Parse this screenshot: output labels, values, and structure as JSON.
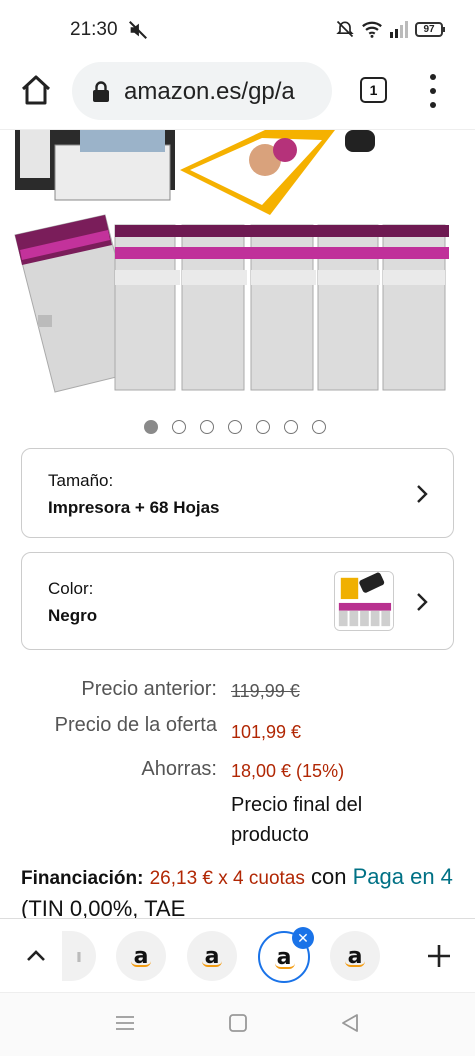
{
  "status_bar": {
    "time": "21:30",
    "battery": "97",
    "icons": [
      "mute-icon",
      "alarm-off-icon",
      "wifi-icon",
      "signal-icon",
      "battery-icon"
    ]
  },
  "browser": {
    "url": "amazon.es/gp/a",
    "tab_count": "1",
    "icons": [
      "home-icon",
      "lock-icon",
      "menu-dots-icon"
    ]
  },
  "carousel": {
    "total": 7,
    "active_index": 0
  },
  "options": {
    "size": {
      "label": "Tamaño:",
      "value": "Impresora + 68 Hojas"
    },
    "color": {
      "label": "Color:",
      "value": "Negro"
    }
  },
  "pricing": {
    "previous_label": "Precio anterior:",
    "previous_value": "119,99 €",
    "offer_label": "Precio de la oferta",
    "offer_value": "101,99 €",
    "savings_label": "Ahorras:",
    "savings_value": "18,00 € (15%)",
    "final_note": "Precio final del producto"
  },
  "financing": {
    "label": "Financiación:",
    "amount": "26,13 € x 4 cuotas",
    "connector": "con",
    "link": "Paga en 4",
    "terms": "(TIN 0,00%, TAE"
  },
  "tab_strip": {
    "tab_letter": "a",
    "close_symbol": "✕",
    "icons": [
      "chevron-up-icon",
      "plus-icon"
    ]
  },
  "colors": {
    "price_red": "#b12704",
    "link_teal": "#007185",
    "selected_tab_blue": "#1a73e8"
  }
}
